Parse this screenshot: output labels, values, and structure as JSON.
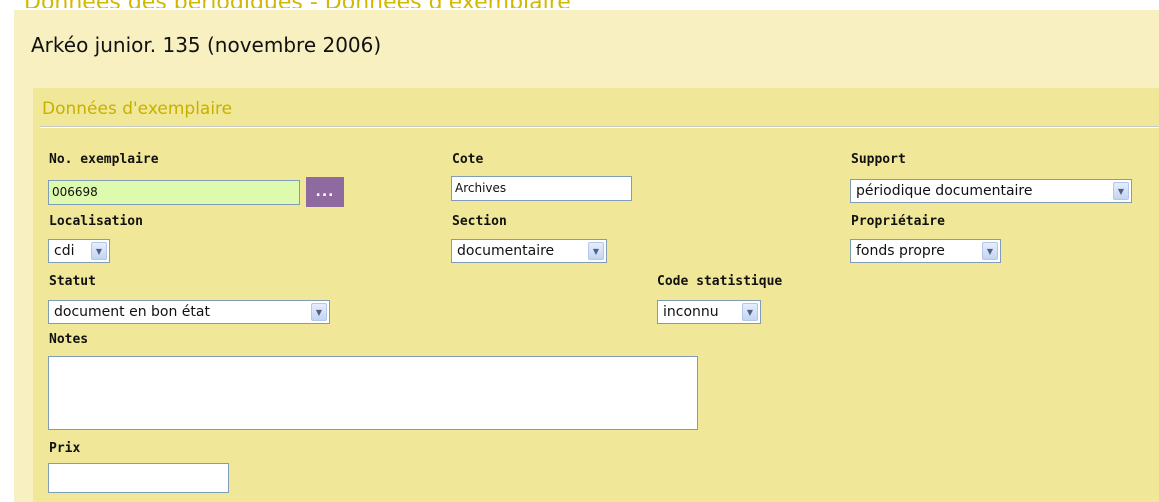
{
  "header": {
    "clipped_text": "Données des périodiques - Données d'exemplaire",
    "title": "Arkéo junior. 135 (novembre 2006)"
  },
  "section": {
    "title": "Données d'exemplaire"
  },
  "fields": {
    "no_exemplaire": {
      "label": "No. exemplaire",
      "value": "006698",
      "browse_label": "..."
    },
    "cote": {
      "label": "Cote",
      "value": "Archives"
    },
    "support": {
      "label": "Support",
      "value": "périodique documentaire"
    },
    "localisation": {
      "label": "Localisation",
      "value": "cdi"
    },
    "section": {
      "label": "Section",
      "value": "documentaire"
    },
    "proprietaire": {
      "label": "Propriétaire",
      "value": "fonds propre"
    },
    "statut": {
      "label": "Statut",
      "value": "document en bon état"
    },
    "code_statistique": {
      "label": "Code statistique",
      "value": "inconnu"
    },
    "notes": {
      "label": "Notes",
      "value": ""
    },
    "prix": {
      "label": "Prix",
      "value": ""
    }
  },
  "icons": {
    "dropdown": "chevron-down-icon"
  },
  "colors": {
    "page_background": "#f8f0c0",
    "panel_background": "#f0e898",
    "section_title": "#c8b000",
    "highlight_input": "#ddfaae",
    "browse_button": "#8e6aa0"
  }
}
